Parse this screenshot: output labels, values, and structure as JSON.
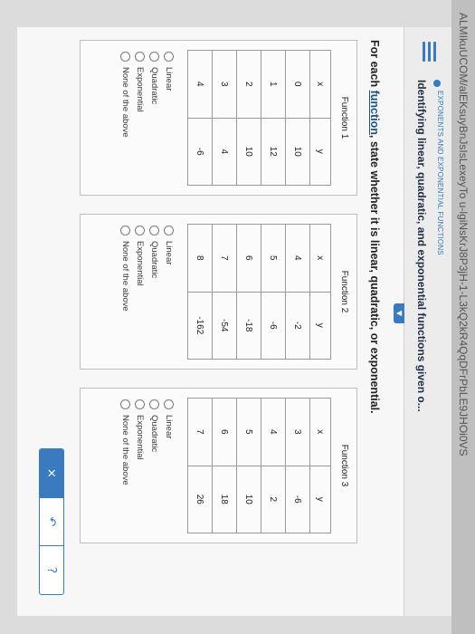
{
  "browser": {
    "url_text": "ALMIkuUCOM/alEKsuyBnJsIsLexeyTo u-lgiNsKrJ8P3jH-1-L3kQ2kR4QqDFrPbLE9JHOi0VS"
  },
  "header": {
    "topic": "EXPONENTS AND EXPONENTIAL FUNCTIONS",
    "title": "Identifying linear, quadratic, and exponential functions given o..."
  },
  "question": {
    "before": "For each ",
    "link": "function",
    "after": ", state whether it is linear, quadratic, or exponential."
  },
  "functions": [
    {
      "title": "Function 1",
      "headers": [
        "x",
        "y"
      ],
      "rows": [
        [
          "0",
          "10"
        ],
        [
          "1",
          "12"
        ],
        [
          "2",
          "10"
        ],
        [
          "3",
          "4"
        ],
        [
          "4",
          "-6"
        ]
      ],
      "options": [
        "Linear",
        "Quadratic",
        "Exponential",
        "None of the above"
      ]
    },
    {
      "title": "Function 2",
      "headers": [
        "x",
        "y"
      ],
      "rows": [
        [
          "4",
          "-2"
        ],
        [
          "5",
          "-6"
        ],
        [
          "6",
          "-18"
        ],
        [
          "7",
          "-54"
        ],
        [
          "8",
          "-162"
        ]
      ],
      "options": [
        "Linear",
        "Quadratic",
        "Exponential",
        "None of the above"
      ]
    },
    {
      "title": "Function 3",
      "headers": [
        "x",
        "y"
      ],
      "rows": [
        [
          "3",
          "-6"
        ],
        [
          "4",
          "2"
        ],
        [
          "5",
          "10"
        ],
        [
          "6",
          "18"
        ],
        [
          "7",
          "26"
        ]
      ],
      "options": [
        "Linear",
        "Quadratic",
        "Exponential",
        "None of the above"
      ]
    }
  ],
  "actions": {
    "clear": "×",
    "undo": "↶",
    "help": "?"
  },
  "colors": {
    "accent": "#3a7bbf",
    "title_text": "#1f2f45"
  }
}
